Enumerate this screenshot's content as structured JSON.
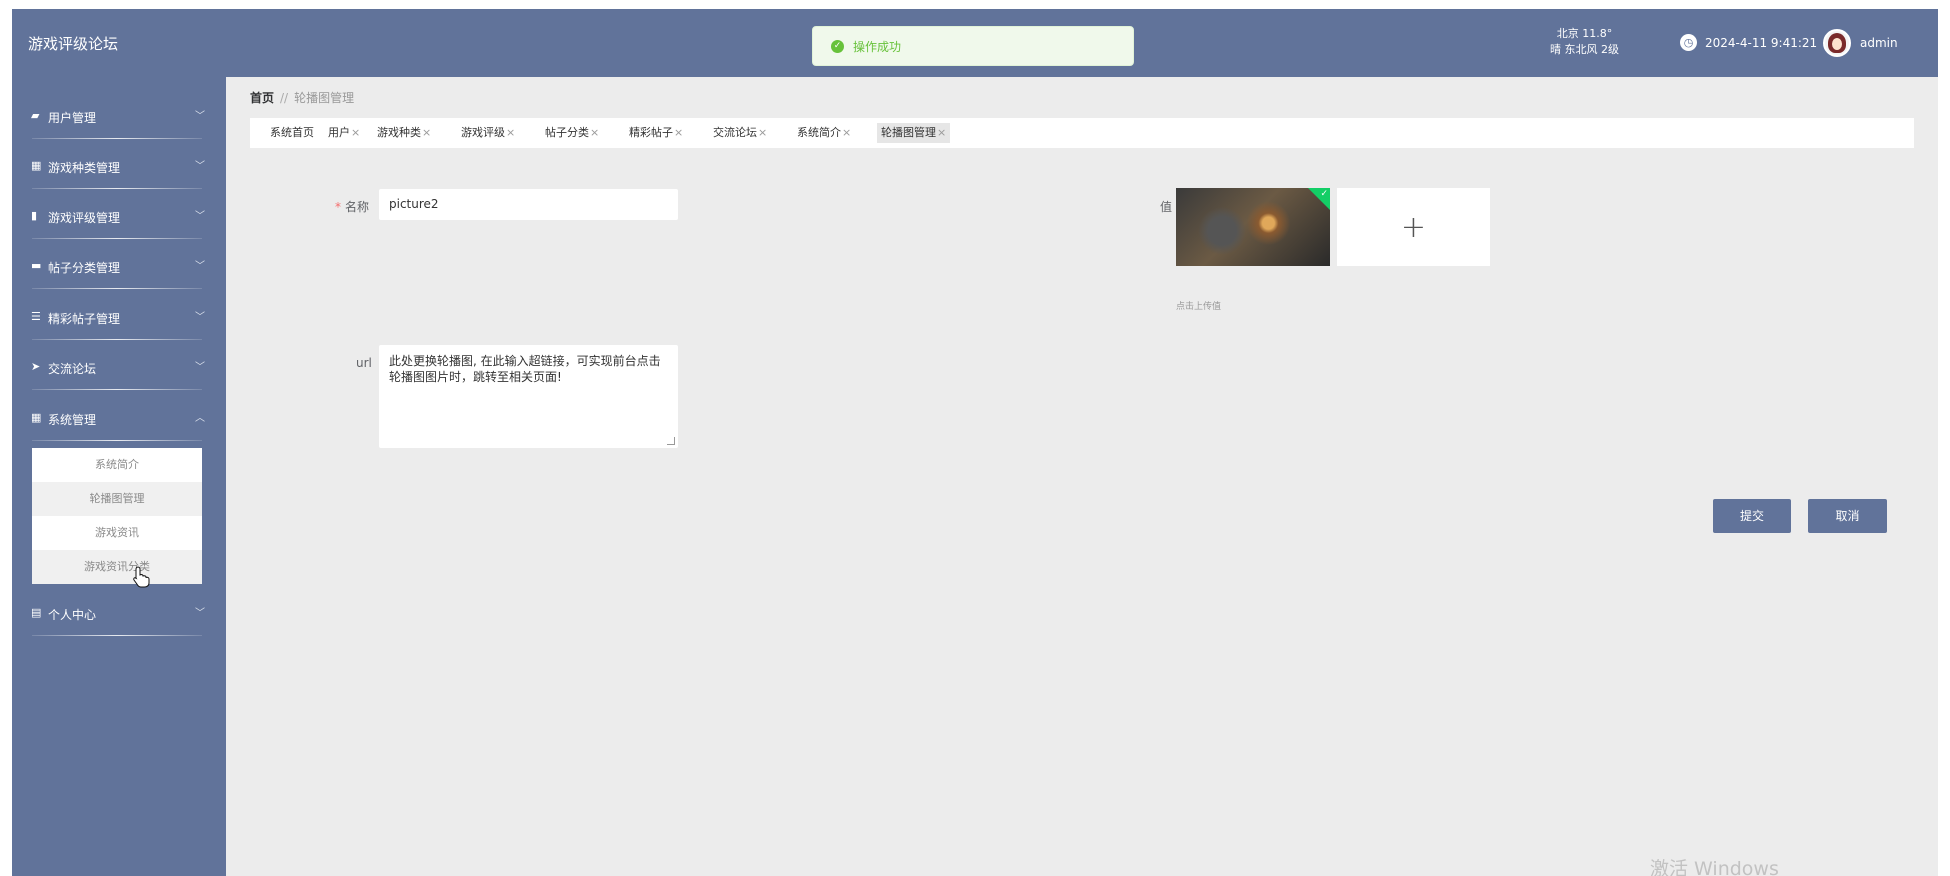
{
  "header": {
    "app_title": "游戏评级论坛",
    "toast": "操作成功",
    "weather_city_temp": "北京 11.8°",
    "weather_desc": "晴 东北风 2级",
    "datetime": "2024-4-11 9:41:21",
    "username": "admin"
  },
  "sidebar": {
    "items": [
      {
        "label": "用户管理",
        "icon": "briefcase-icon",
        "glyph": "▰"
      },
      {
        "label": "游戏种类管理",
        "icon": "grid-icon",
        "glyph": "▦"
      },
      {
        "label": "游戏评级管理",
        "icon": "bar-chart-icon",
        "glyph": "▮"
      },
      {
        "label": "帖子分类管理",
        "icon": "comment-icon",
        "glyph": "▬"
      },
      {
        "label": "精彩帖子管理",
        "icon": "sliders-icon",
        "glyph": "☰"
      },
      {
        "label": "交流论坛",
        "icon": "send-icon",
        "glyph": "➤"
      },
      {
        "label": "系统管理",
        "icon": "grid-icon",
        "glyph": "▦"
      },
      {
        "label": "个人中心",
        "icon": "calendar-icon",
        "glyph": "▤"
      }
    ],
    "submenu": [
      "系统简介",
      "轮播图管理",
      "游戏资讯",
      "游戏资讯分类"
    ]
  },
  "breadcrumb": {
    "home": "首页",
    "separator": "//",
    "current": "轮播图管理"
  },
  "tabs": [
    {
      "label": "系统首页",
      "close": ""
    },
    {
      "label": "用户",
      "close": "×"
    },
    {
      "label": "游戏种类",
      "close": "×"
    },
    {
      "label": "游戏评级",
      "close": "×"
    },
    {
      "label": "帖子分类",
      "close": "×"
    },
    {
      "label": "精彩帖子",
      "close": "×"
    },
    {
      "label": "交流论坛",
      "close": "×"
    },
    {
      "label": "系统简介",
      "close": "×"
    },
    {
      "label": "轮播图管理",
      "close": "×"
    }
  ],
  "form": {
    "name_required": "*",
    "name_label": "名称",
    "name_value": "picture2",
    "value_label": "值",
    "upload_plus": "+",
    "upload_tip": "点击上传值",
    "url_label": "url",
    "url_value": "此处更换轮播图, 在此输入超链接，可实现前台点击轮播图图片时，跳转至相关页面!",
    "submit_label": "提交",
    "cancel_label": "取消"
  },
  "watermark": "激活 Windows",
  "colors": {
    "header_bg": "#61739a",
    "sidebar_bg": "#61739a",
    "content_bg": "#ececec",
    "success": "#67c23a",
    "primary_button": "#61739a"
  }
}
